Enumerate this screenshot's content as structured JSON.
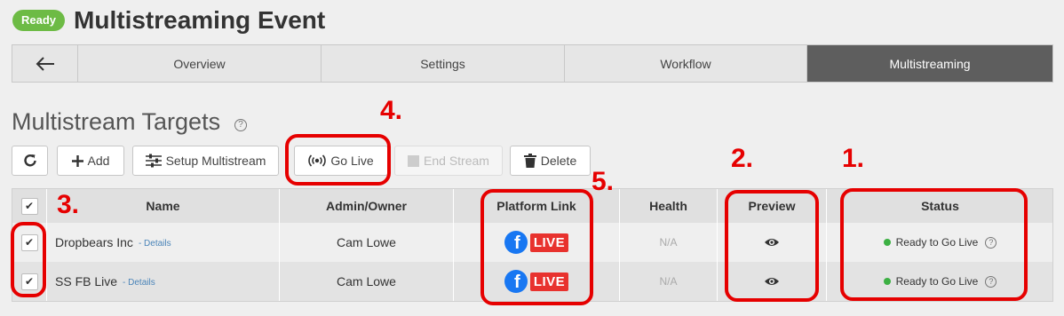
{
  "header": {
    "badge": "Ready",
    "title": "Multistreaming Event"
  },
  "tabs": {
    "back_icon": "arrow-left-icon",
    "items": [
      "Overview",
      "Settings",
      "Workflow",
      "Multistreaming"
    ],
    "active": "Multistreaming"
  },
  "section": {
    "title": "Multistream Targets",
    "help": "?"
  },
  "toolbar": {
    "refresh_icon": "refresh-icon",
    "add_label": "Add",
    "setup_label": "Setup Multistream",
    "go_live_label": "Go Live",
    "end_stream_label": "End Stream",
    "delete_label": "Delete"
  },
  "table": {
    "columns": [
      "Name",
      "Admin/Owner",
      "Platform Link",
      "Health",
      "Preview",
      "Status"
    ],
    "rows": [
      {
        "name": "Dropbears Inc",
        "details": "- Details",
        "owner": "Cam Lowe",
        "platform": "LIVE",
        "health": "N/A",
        "status": "Ready to Go Live",
        "checked": true
      },
      {
        "name": "SS FB Live",
        "details": "- Details",
        "owner": "Cam Lowe",
        "platform": "LIVE",
        "health": "N/A",
        "status": "Ready to Go Live",
        "checked": true
      }
    ]
  },
  "annotations": [
    "1.",
    "2.",
    "3.",
    "4.",
    "5."
  ],
  "colors": {
    "badge": "#6dbb45",
    "active_tab": "#5e5e5e",
    "annotation": "#e60000",
    "facebook": "#1877f2",
    "live": "#e8322e",
    "status_dot": "#3cb043"
  }
}
